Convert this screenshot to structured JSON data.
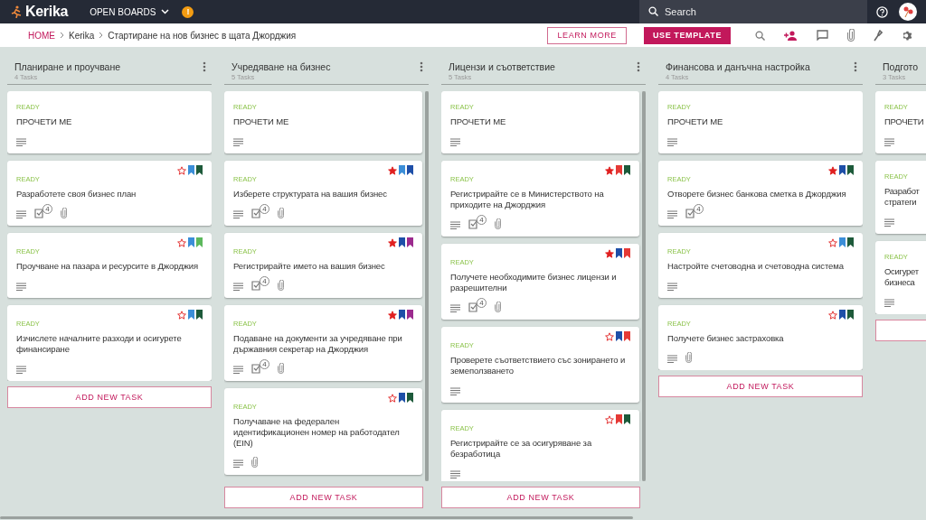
{
  "topbar": {
    "logo": "Kerika",
    "menu": "OPEN BOARDS",
    "alert": "!",
    "search_placeholder": "Search"
  },
  "breadcrumb": [
    "HOME",
    "Kerika",
    "Стартиране на нов бизнес в щата Джорджия"
  ],
  "actions": {
    "learn_more": "LEARN MORE",
    "use_template": "USE TEMPLATE"
  },
  "columns": [
    {
      "title": "Планиране и проучване",
      "count": "4 Tasks",
      "scrolls": false,
      "add_label": "ADD NEW TASK",
      "tasks": [
        {
          "status": "READY",
          "title": "ПРОЧЕТИ МЕ",
          "description": true,
          "attachment": false
        },
        {
          "status": "READY",
          "title": "Разработете своя бизнес план",
          "starred": false,
          "bookmarks": [
            {
              "color": "#3b8ed8"
            },
            {
              "color": "#1d5a3a"
            }
          ],
          "description": true,
          "checklist": "4",
          "attachment": true
        },
        {
          "status": "READY",
          "title": "Проучване на пазара и ресурсите в Джорджия",
          "starred": false,
          "bookmarks": [
            {
              "color": "#3b8ed8"
            },
            {
              "color": "#5cb85c"
            }
          ],
          "description": true,
          "attachment": false
        },
        {
          "status": "READY",
          "title": "Изчислете началните разходи и осигурете финансиране",
          "starred": false,
          "bookmarks": [
            {
              "color": "#3b8ed8"
            },
            {
              "color": "#1d5a3a"
            }
          ],
          "description": true,
          "attachment": false
        }
      ]
    },
    {
      "title": "Учредяване на бизнес",
      "count": "5 Tasks",
      "scrolls": true,
      "add_label": "ADD NEW TASK",
      "tasks": [
        {
          "status": "READY",
          "title": "ПРОЧЕТИ МЕ",
          "description": true,
          "attachment": false
        },
        {
          "status": "READY",
          "title": "Изберете структурата на вашия бизнес",
          "starred": true,
          "bookmarks": [
            {
              "color": "#3b8ed8"
            },
            {
              "color": "#1e4fa8"
            }
          ],
          "description": true,
          "checklist": "4",
          "attachment": true
        },
        {
          "status": "READY",
          "title": "Регистрирайте името на вашия бизнес",
          "starred": true,
          "bookmarks": [
            {
              "color": "#1e4fa8"
            },
            {
              "color": "#9c2a8e"
            }
          ],
          "description": true,
          "checklist": "4",
          "attachment": true
        },
        {
          "status": "READY",
          "title": "Подаване на документи за учредяване при държавния секретар на Джорджия",
          "starred": true,
          "bookmarks": [
            {
              "color": "#1e4fa8"
            },
            {
              "color": "#9c2a8e"
            }
          ],
          "description": true,
          "checklist": "4",
          "attachment": true
        },
        {
          "status": "READY",
          "title": "Получаване на федерален идентификационен номер на работодател (EIN)",
          "starred": false,
          "bookmarks": [
            {
              "color": "#1e4fa8"
            },
            {
              "color": "#1d5a3a"
            }
          ],
          "description": true,
          "attachment": true
        }
      ]
    },
    {
      "title": "Лицензи и съответствие",
      "count": "5 Tasks",
      "scrolls": true,
      "add_label": "ADD NEW TASK",
      "tasks": [
        {
          "status": "READY",
          "title": "ПРОЧЕТИ МЕ",
          "description": true,
          "attachment": false
        },
        {
          "status": "READY",
          "title": "Регистрирайте се в Министерството на приходите на Джорджия",
          "starred": true,
          "bookmarks": [
            {
              "color": "#e53935"
            },
            {
              "color": "#1d5a3a"
            }
          ],
          "description": true,
          "checklist": "4",
          "attachment": true
        },
        {
          "status": "READY",
          "title": "Получете необходимите бизнес лицензи и разрешителни",
          "starred": true,
          "bookmarks": [
            {
              "color": "#1e4fa8"
            },
            {
              "color": "#e53935"
            }
          ],
          "description": true,
          "checklist": "4",
          "attachment": true
        },
        {
          "status": "READY",
          "title": "Проверете съответствието със зонирането и земеползването",
          "starred": false,
          "bookmarks": [
            {
              "color": "#1e4fa8"
            },
            {
              "color": "#e53935"
            }
          ],
          "description": true,
          "attachment": false
        },
        {
          "status": "READY",
          "title": "Регистрирайте се за осигуряване за безработица",
          "starred": false,
          "bookmarks": [
            {
              "color": "#e53935"
            },
            {
              "color": "#1d5a3a"
            }
          ],
          "description": true,
          "attachment": false
        }
      ]
    },
    {
      "title": "Финансова и данъчна настройка",
      "count": "4 Tasks",
      "scrolls": false,
      "add_label": "ADD NEW TASK",
      "tasks": [
        {
          "status": "READY",
          "title": "ПРОЧЕТИ МЕ",
          "description": true,
          "attachment": false
        },
        {
          "status": "READY",
          "title": "Отворете бизнес банкова сметка в Джорджия",
          "starred": true,
          "bookmarks": [
            {
              "color": "#1e4fa8"
            },
            {
              "color": "#1d5a3a"
            }
          ],
          "description": true,
          "checklist": "4",
          "attachment": false
        },
        {
          "status": "READY",
          "title": "Настройте счетоводна и счетоводна система",
          "starred": false,
          "bookmarks": [
            {
              "color": "#3b8ed8"
            },
            {
              "color": "#1d5a3a"
            }
          ],
          "description": true,
          "attachment": false
        },
        {
          "status": "READY",
          "title": "Получете бизнес застраховка",
          "starred": false,
          "bookmarks": [
            {
              "color": "#1e4fa8"
            },
            {
              "color": "#1d5a3a"
            }
          ],
          "description": true,
          "attachment": true
        }
      ]
    },
    {
      "title": "Подгото",
      "count": "3 Tasks",
      "scrolls": false,
      "tasks": [
        {
          "status": "READY",
          "title": "ПРОЧЕТИ",
          "description": true,
          "attachment": false
        },
        {
          "status": "READY",
          "title": "Разработ\nстратеги",
          "description": true,
          "attachment": false
        },
        {
          "status": "READY",
          "title": "Осигурет\nбизнеса",
          "description": true,
          "attachment": false
        }
      ]
    }
  ]
}
